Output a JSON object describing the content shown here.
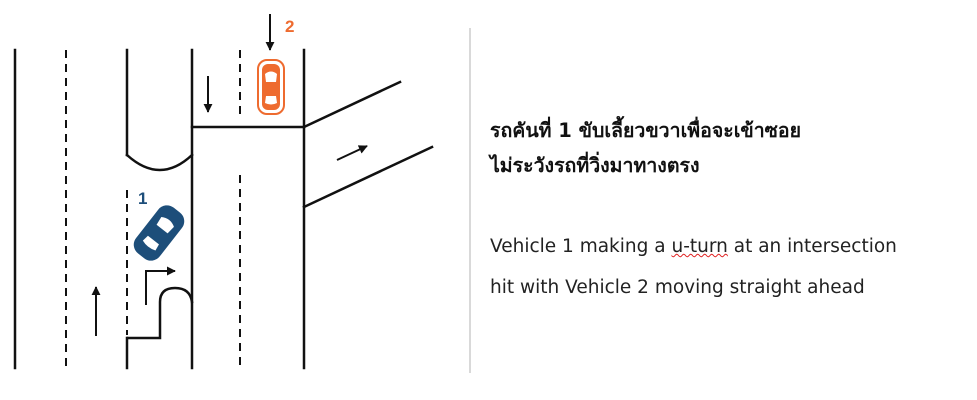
{
  "diagram": {
    "vehicle_1": {
      "number": "1",
      "color": "#1d4e7a"
    },
    "vehicle_2": {
      "number": "2",
      "color": "#ee6b2f"
    }
  },
  "caption": {
    "thai_line1": "รถคันที่ 1 ขับเลี้ยวขวาเพื่อจะเข้าซอย",
    "thai_line2": "ไม่ระวังรถที่วิ่งมาทางตรง",
    "english_line1_before": "Vehicle 1 making a ",
    "english_line1_underlined": "u-turn",
    "english_line1_after": " at an intersection",
    "english_line2": "hit with Vehicle 2 moving straight ahead"
  }
}
